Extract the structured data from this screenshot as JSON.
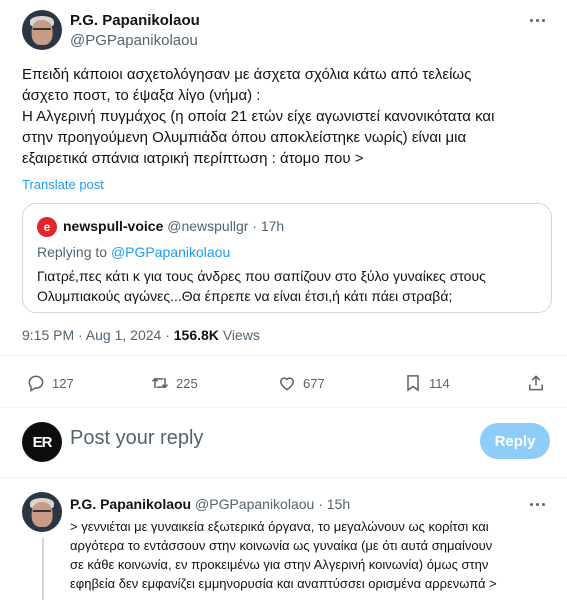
{
  "tweet": {
    "author_name": "P.G. Papanikolaou",
    "author_handle": "@PGPapanikolaou",
    "lines": [
      "Επειδή κάποιοι ασχετολόγησαν με άσχετα σχόλια κάτω από τελείως",
      "άσχετο ποστ, το έψαξα λίγο (νήμα) :",
      "Η Αλγερινή πυγμάχος (η οποία 21 ετών είχε αγωνιστεί κανονικότατα και",
      "στην προηγούμενη Ολυμπιάδα όπου αποκλείστηκε νωρίς) είναι μια",
      "εξαιρετικά σπάνια ιατρική περίπτωση : άτομο που >"
    ],
    "translate_label": "Translate post",
    "quote": {
      "logo_letter": "e",
      "author_name": "newspull-voice",
      "author_handle": "@newspullgr",
      "separator": "·",
      "time": "17h",
      "replying_prefix": "Replying to",
      "replying_to": "@PGPapanikolaou",
      "lines": [
        "Γιατρέ,πες κάτι κ για τους άνδρες που σαπίζουν στο ξύλο γυναίκες στους",
        "Ολυμπιακούς αγώνες...Θα έπρεπε να είναι έτσι,ή κάτι πάει στραβά;"
      ]
    },
    "timestamp": "9:15 PM · Aug 1, 2024 ·",
    "views_count": "156.8K",
    "views_label": "Views",
    "actions": {
      "replies": "127",
      "reposts": "225",
      "likes": "677",
      "bookmarks": "114"
    }
  },
  "reply_box": {
    "avatar_initials": "ER",
    "placeholder": "Post your reply",
    "button_label": "Reply"
  },
  "reply_tweet": {
    "author_name": "P.G. Papanikolaou",
    "author_handle": "@PGPapanikolaou",
    "separator": "·",
    "time": "15h",
    "lines": [
      "> γεννιέται με γυναικεία εξωτερικά όργανα, το μεγαλώνουν ως κορίτσι και",
      "αργότερα το εντάσσουν στην κοινωνία ως γυναίκα (με ότι αυτά σημαίνουν",
      "σε κάθε κοινωνία, εν προκειμένω για στην Αλγερινή κοινωνία) όμως στην",
      "εφηβεία δεν εμφανίζει εμμηνορυσία και αναπτύσσει ορισμένα αρρενωπά >"
    ]
  },
  "colors": {
    "accent": "#1d9bf0",
    "secondary_text": "#536471",
    "reply_button_disabled": "#8ecdf7",
    "quote_logo": "#e2252b"
  }
}
